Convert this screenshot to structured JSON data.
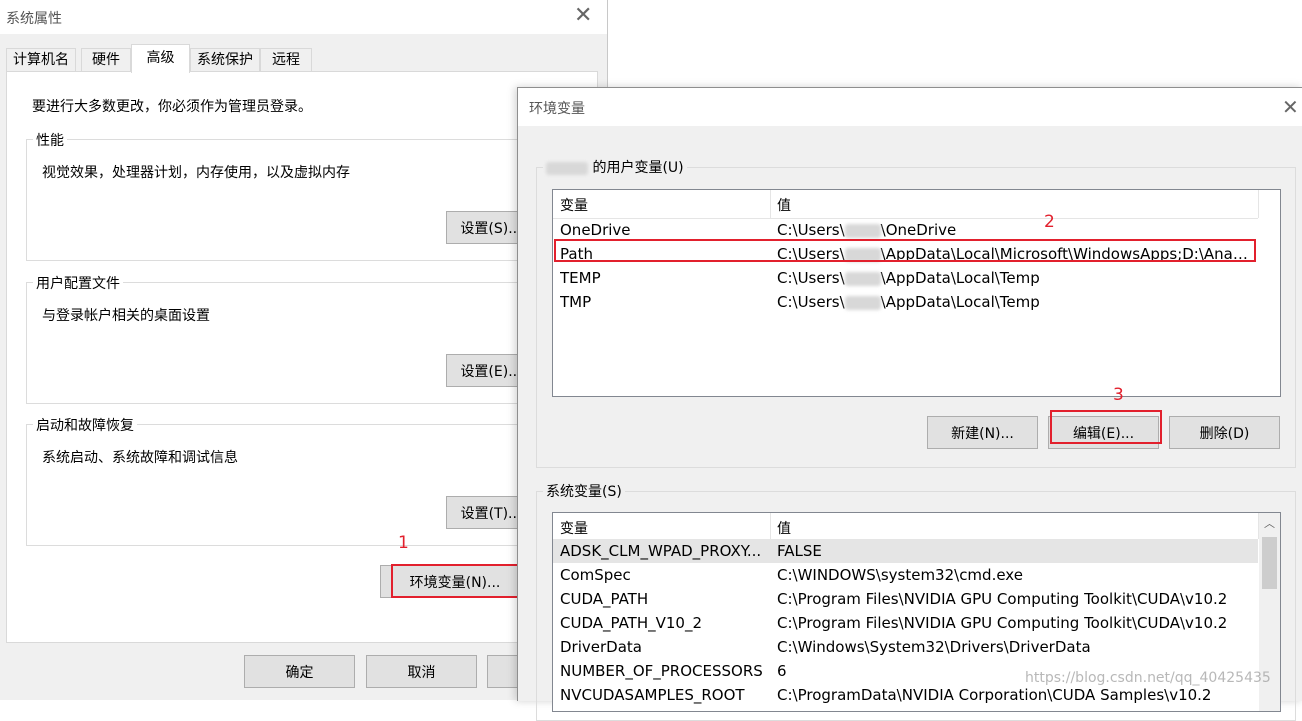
{
  "system_properties": {
    "title": "系统属性",
    "tabs": [
      "计算机名",
      "硬件",
      "高级",
      "系统保护",
      "远程"
    ],
    "admin_note": "要进行大多数更改，你必须作为管理员登录。",
    "groups": [
      {
        "title": "性能",
        "description": "视觉效果，处理器计划，内存使用，以及虚拟内存",
        "button": "设置(S)..."
      },
      {
        "title": "用户配置文件",
        "description": "与登录帐户相关的桌面设置",
        "button": "设置(E)..."
      },
      {
        "title": "启动和故障恢复",
        "description": "系统启动、系统故障和调试信息",
        "button": "设置(T)..."
      }
    ],
    "env_button": "环境变量(N)...",
    "ok_button": "确定",
    "cancel_button": "取消"
  },
  "env_dialog": {
    "title": "环境变量",
    "user_group_suffix": "的用户变量(U)",
    "user_group_blurred_name": "llllulu",
    "columns": {
      "variable": "变量",
      "value": "值"
    },
    "user_vars": [
      {
        "name": "OneDrive",
        "value_pre": "C:\\Users\\",
        "value_blur": "llllulu",
        "value_post": "\\OneDrive"
      },
      {
        "name": "Path",
        "value_pre": "C:\\Users\\",
        "value_blur": "llllulu",
        "value_post": "\\AppData\\Local\\Microsoft\\WindowsApps;D:\\Anac..."
      },
      {
        "name": "TEMP",
        "value_pre": "C:\\Users\\",
        "value_blur": "llllulu",
        "value_post": "\\AppData\\Local\\Temp"
      },
      {
        "name": "TMP",
        "value_pre": "C:\\Users\\",
        "value_blur": "llllulu",
        "value_post": "\\AppData\\Local\\Temp"
      }
    ],
    "user_buttons": {
      "new": "新建(N)...",
      "edit": "编辑(E)...",
      "delete": "删除(D)"
    },
    "system_group_title": "系统变量(S)",
    "system_vars": [
      {
        "name": "ADSK_CLM_WPAD_PROXY...",
        "value": "FALSE"
      },
      {
        "name": "ComSpec",
        "value": "C:\\WINDOWS\\system32\\cmd.exe"
      },
      {
        "name": "CUDA_PATH",
        "value": "C:\\Program Files\\NVIDIA GPU Computing Toolkit\\CUDA\\v10.2"
      },
      {
        "name": "CUDA_PATH_V10_2",
        "value": "C:\\Program Files\\NVIDIA GPU Computing Toolkit\\CUDA\\v10.2"
      },
      {
        "name": "DriverData",
        "value": "C:\\Windows\\System32\\Drivers\\DriverData"
      },
      {
        "name": "NUMBER_OF_PROCESSORS",
        "value": "6"
      },
      {
        "name": "NVCUDASAMPLES_ROOT",
        "value": "C:\\ProgramData\\NVIDIA Corporation\\CUDA Samples\\v10.2"
      }
    ]
  },
  "annotations": [
    "1",
    "2",
    "3"
  ],
  "watermark": "https://blog.csdn.net/qq_40425435",
  "colors": {
    "highlight": "#e2202d",
    "selected_row": "#e5e5e5",
    "button_face": "#e1e1e1"
  }
}
